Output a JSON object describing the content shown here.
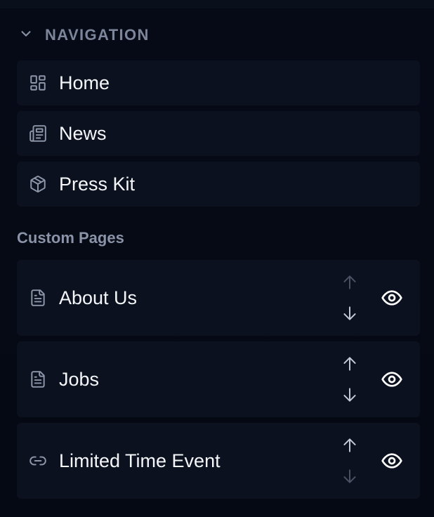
{
  "navigation": {
    "title": "NAVIGATION",
    "collapse_icon": "chevron-down-icon",
    "items": [
      {
        "label": "Home",
        "icon": "layout-grid-icon"
      },
      {
        "label": "News",
        "icon": "newspaper-icon"
      },
      {
        "label": "Press Kit",
        "icon": "package-icon"
      }
    ]
  },
  "custom_pages": {
    "title": "Custom Pages",
    "items": [
      {
        "label": "About Us",
        "icon": "file-text-icon",
        "up_enabled": false,
        "down_enabled": true,
        "visible": true
      },
      {
        "label": "Jobs",
        "icon": "file-text-icon",
        "up_enabled": true,
        "down_enabled": true,
        "visible": true
      },
      {
        "label": "Limited Time Event",
        "icon": "link-icon",
        "up_enabled": true,
        "down_enabled": false,
        "visible": true
      }
    ]
  },
  "colors": {
    "background": "#060a16",
    "card": "#0b111e",
    "heading_muted": "#7c859a",
    "text": "#f4f6fa",
    "arrow_enabled": "#c5cbd8",
    "arrow_disabled": "#4a5264"
  }
}
